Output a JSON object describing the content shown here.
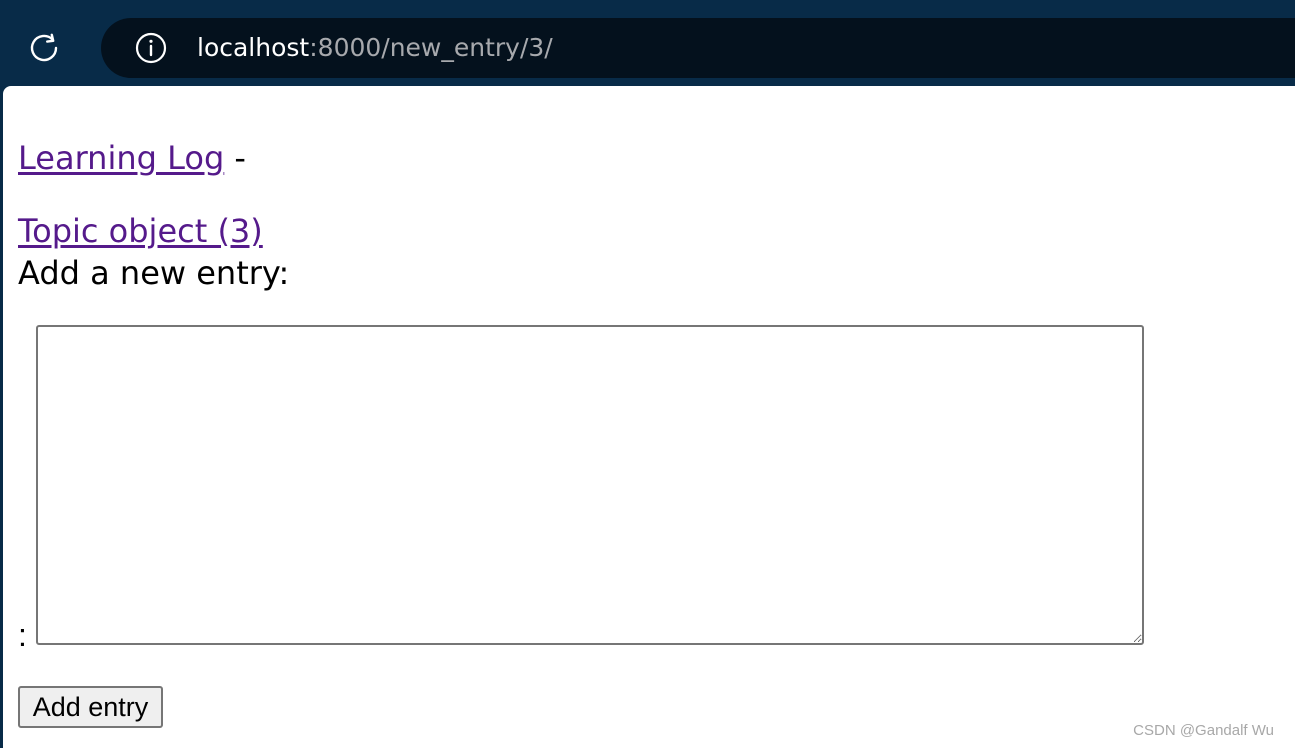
{
  "browser": {
    "url_host": "localhost",
    "url_path": ":8000/new_entry/3/",
    "icons": {
      "reload": "reload-icon",
      "site_info": "info-icon"
    }
  },
  "page": {
    "site_link": "Learning Log",
    "nav_separator": " -",
    "topic_link": "Topic object (3)",
    "heading": "Add a new entry:",
    "field_label": ":",
    "textarea_value": "",
    "submit_label": "Add entry",
    "watermark": "CSDN @Gandalf Wu"
  },
  "colors": {
    "toolbar": "#082b48",
    "address_bar": "#04111d",
    "link_visited": "#551a8b",
    "url_path": "#a7a9ad",
    "button_background": "#efefef",
    "control_border": "#767676"
  }
}
